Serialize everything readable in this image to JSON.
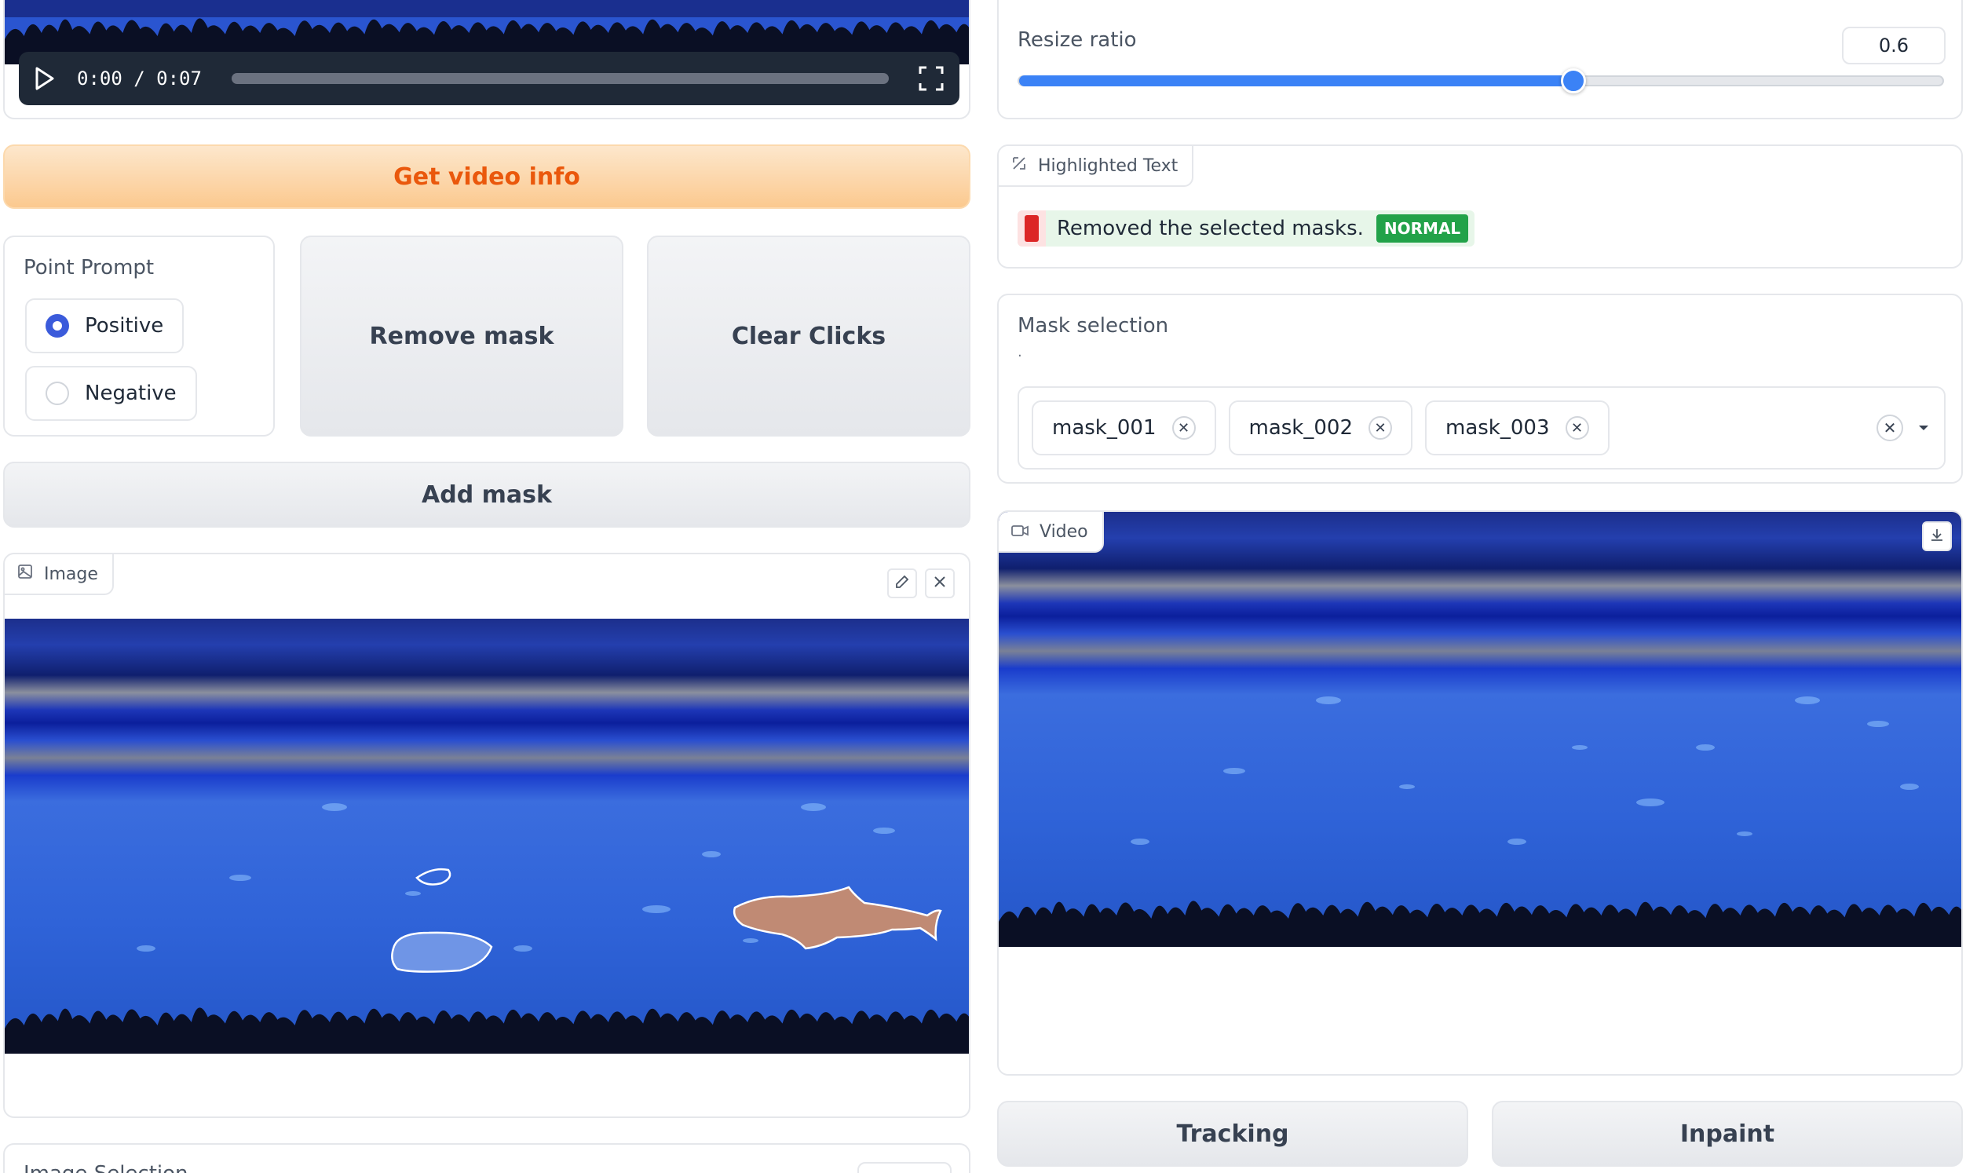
{
  "video_player": {
    "time_display": "0:00 / 0:07",
    "progress": 0.0
  },
  "buttons": {
    "get_video_info": "Get video info",
    "remove_mask": "Remove mask",
    "clear_clicks": "Clear Clicks",
    "add_mask": "Add mask",
    "tracking": "Tracking",
    "inpaint": "Inpaint"
  },
  "point_prompt": {
    "label": "Point Prompt",
    "options": [
      "Positive",
      "Negative"
    ],
    "selected": "Positive"
  },
  "image_panel": {
    "label": "Image"
  },
  "image_selection": {
    "label": "Image Selection"
  },
  "resize_ratio": {
    "label": "Resize ratio",
    "value": "0.6",
    "slider_fraction": 0.6
  },
  "highlighted_text": {
    "label": "Highlighted Text",
    "text": "Removed the selected masks.",
    "tag": "NORMAL"
  },
  "mask_selection": {
    "label": "Mask selection",
    "info": ".",
    "chips": [
      "mask_001",
      "mask_002",
      "mask_003"
    ]
  },
  "video_panel": {
    "label": "Video"
  },
  "colors": {
    "accent_blue": "#3b82f6",
    "orange_text": "#ea580c",
    "normal_green": "#22a249",
    "red_marker": "#dc2626"
  }
}
